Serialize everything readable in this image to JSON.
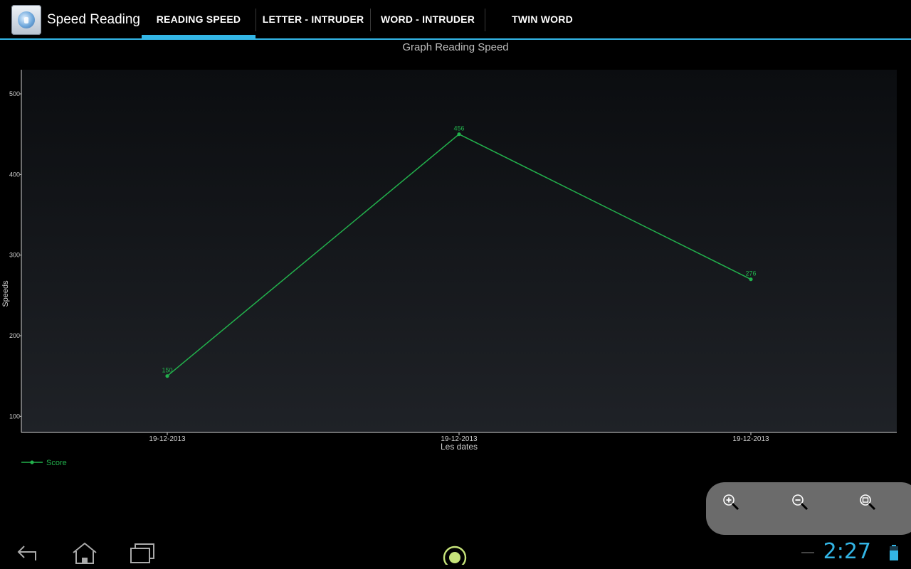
{
  "app": {
    "title": "Speed Reading"
  },
  "tabs": [
    {
      "label": "READING SPEED",
      "selected": true
    },
    {
      "label": "LETTER - INTRUDER",
      "selected": false
    },
    {
      "label": "WORD - INTRUDER",
      "selected": false
    },
    {
      "label": "TWIN WORD",
      "selected": false
    }
  ],
  "chart_data": {
    "type": "line",
    "title": "Graph Reading Speed",
    "xlabel": "Les dates",
    "ylabel": "Speeds",
    "categories": [
      "19-12-2013",
      "19-12-2013",
      "19-12-2013"
    ],
    "series": [
      {
        "name": "Score",
        "color": "#22b14c",
        "values": [
          150,
          450,
          270
        ],
        "point_labels": [
          "150",
          "456",
          "276"
        ]
      }
    ],
    "yticks": [
      100,
      200,
      300,
      400,
      500
    ],
    "ylim": [
      80,
      530
    ],
    "legend": "bottom-left",
    "grid": false
  },
  "zoom": {
    "icons": [
      "zoom-in-icon",
      "zoom-out-icon",
      "zoom-reset-icon"
    ]
  },
  "system_bar": {
    "time": "2:27",
    "accent": "#33b5e5"
  }
}
